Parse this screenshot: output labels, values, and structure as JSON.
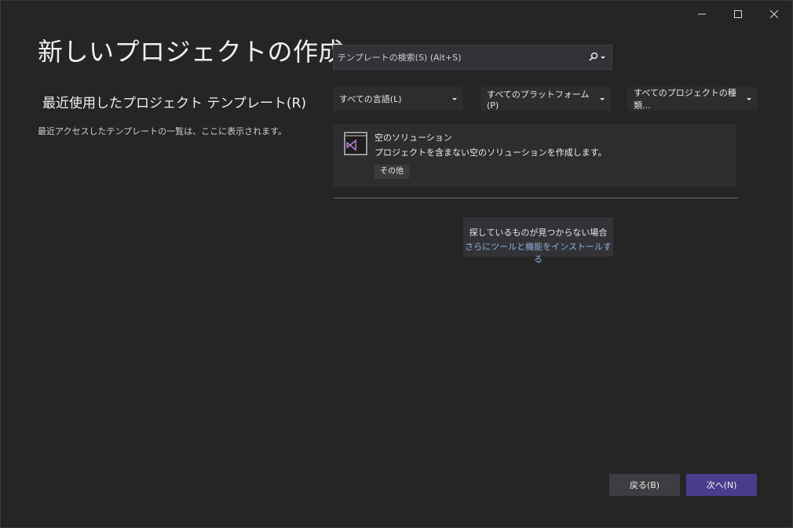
{
  "window": {
    "title": "新しいプロジェクトの作成",
    "caption": {
      "minimize": "—",
      "maximize": "☐",
      "close": "✕"
    }
  },
  "recent": {
    "title": "最近使用したプロジェクト テンプレート(R)",
    "description": "最近アクセスしたテンプレートの一覧は、ここに表示されます。"
  },
  "search": {
    "placeholder": "テンプレートの検索(S) (Alt+S)",
    "value": "",
    "icon": "search-icon"
  },
  "filters": {
    "language": "すべての言語(L)",
    "platform": "すべてのプラットフォーム(P)",
    "project_type": "すべてのプロジェクトの種類..."
  },
  "templates": [
    {
      "name": "空のソリューション",
      "description": "プロジェクトを含まない空のソリューションを作成します。",
      "tag": "その他",
      "icon": "visual-studio-solution-icon",
      "accent": "#b180d7"
    }
  ],
  "not_found": {
    "line1": "探しているものが見つからない場合",
    "link": "さらにツールと機能をインストールする"
  },
  "footer": {
    "back_label": "戻る(B)",
    "next_label": "次へ(N)"
  },
  "colors": {
    "background": "#252526",
    "primary_button": "#4b3b8c",
    "link": "#8fb3e0"
  }
}
